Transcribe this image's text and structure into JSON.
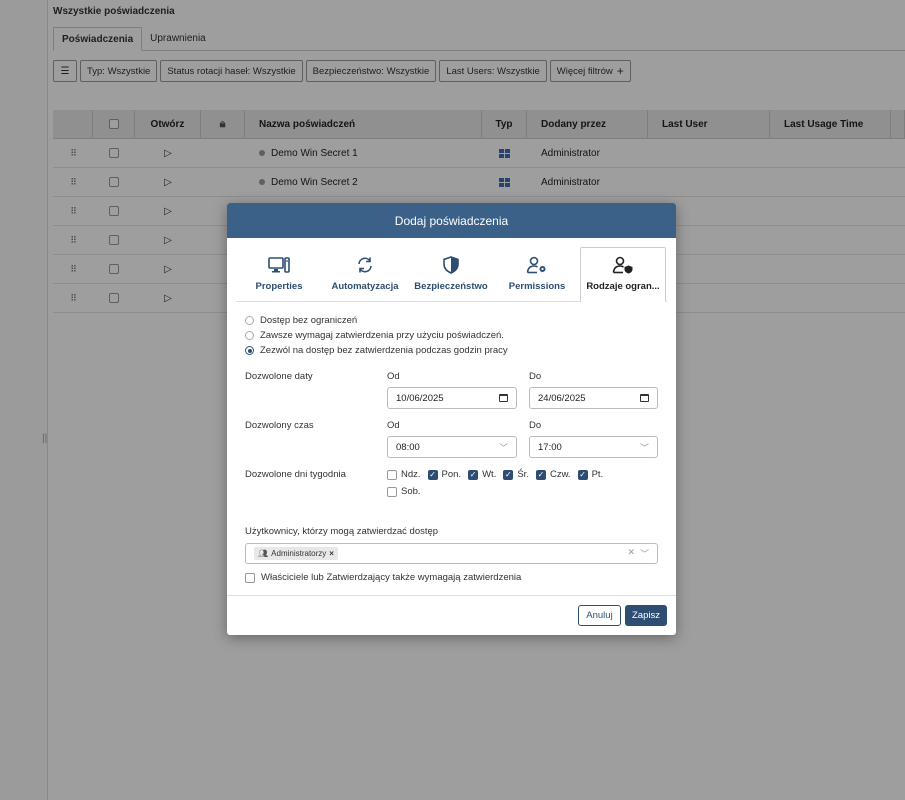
{
  "page": {
    "title": "Wszystkie poświadczenia",
    "tabs": [
      "Poświadczenia",
      "Uprawnienia"
    ],
    "filters": [
      "Typ: Wszystkie",
      "Status rotacji haseł: Wszystkie",
      "Bezpieczeństwo: Wszystkie",
      "Last Users: Wszystkie",
      "Więcej filtrów"
    ],
    "filter_more_icon": "+",
    "gutter_handle": "||"
  },
  "table": {
    "headers": [
      "Otwórz",
      "Nazwa poświadczeń",
      "Typ",
      "Dodany przez",
      "Last User",
      "Last Usage Time"
    ],
    "rows": [
      {
        "name": "Demo Win Secret 1",
        "added_by": "Administrator"
      },
      {
        "name": "Demo Win Secret 2",
        "added_by": "Administrator"
      }
    ]
  },
  "modal": {
    "title": "Dodaj poświadczenia",
    "tabs": [
      "Properties",
      "Automatyzacja",
      "Bezpieczeństwo",
      "Permissions",
      "Rodzaje ogran..."
    ],
    "access_options": [
      "Dostęp bez ograniczeń",
      "Zawsze wymagaj zatwierdzenia przy użyciu poświadczeń.",
      "Zezwól na dostęp bez zatwierdzenia podczas godzin pracy"
    ],
    "selected_option": 2,
    "dates": {
      "label": "Dozwolone daty",
      "from_label": "Od",
      "to_label": "Do",
      "from": "10/06/2025",
      "to": "24/06/2025"
    },
    "time": {
      "label": "Dozwolony czas",
      "from_label": "Od",
      "to_label": "Do",
      "from": "08:00",
      "to": "17:00"
    },
    "weekdays": {
      "label": "Dozwolone dni tygodnia",
      "days": [
        {
          "name": "Ndz.",
          "checked": false
        },
        {
          "name": "Pon.",
          "checked": true
        },
        {
          "name": "Wt.",
          "checked": true
        },
        {
          "name": "Śr.",
          "checked": true
        },
        {
          "name": "Czw.",
          "checked": true
        },
        {
          "name": "Pt.",
          "checked": true
        },
        {
          "name": "Sob.",
          "checked": false
        }
      ]
    },
    "approvers": {
      "label": "Użytkownicy, którzy mogą zatwierdzać dostęp",
      "tag": "Administratorzy"
    },
    "owners_checkbox": "Właściciele lub Zatwierdzający także wymagają zatwierdzenia",
    "cancel": "Anuluj",
    "save": "Zapisz"
  },
  "colors": {
    "primary": "#3b6188",
    "accent": "#2d4e72",
    "windows": "#3a6fb0"
  }
}
